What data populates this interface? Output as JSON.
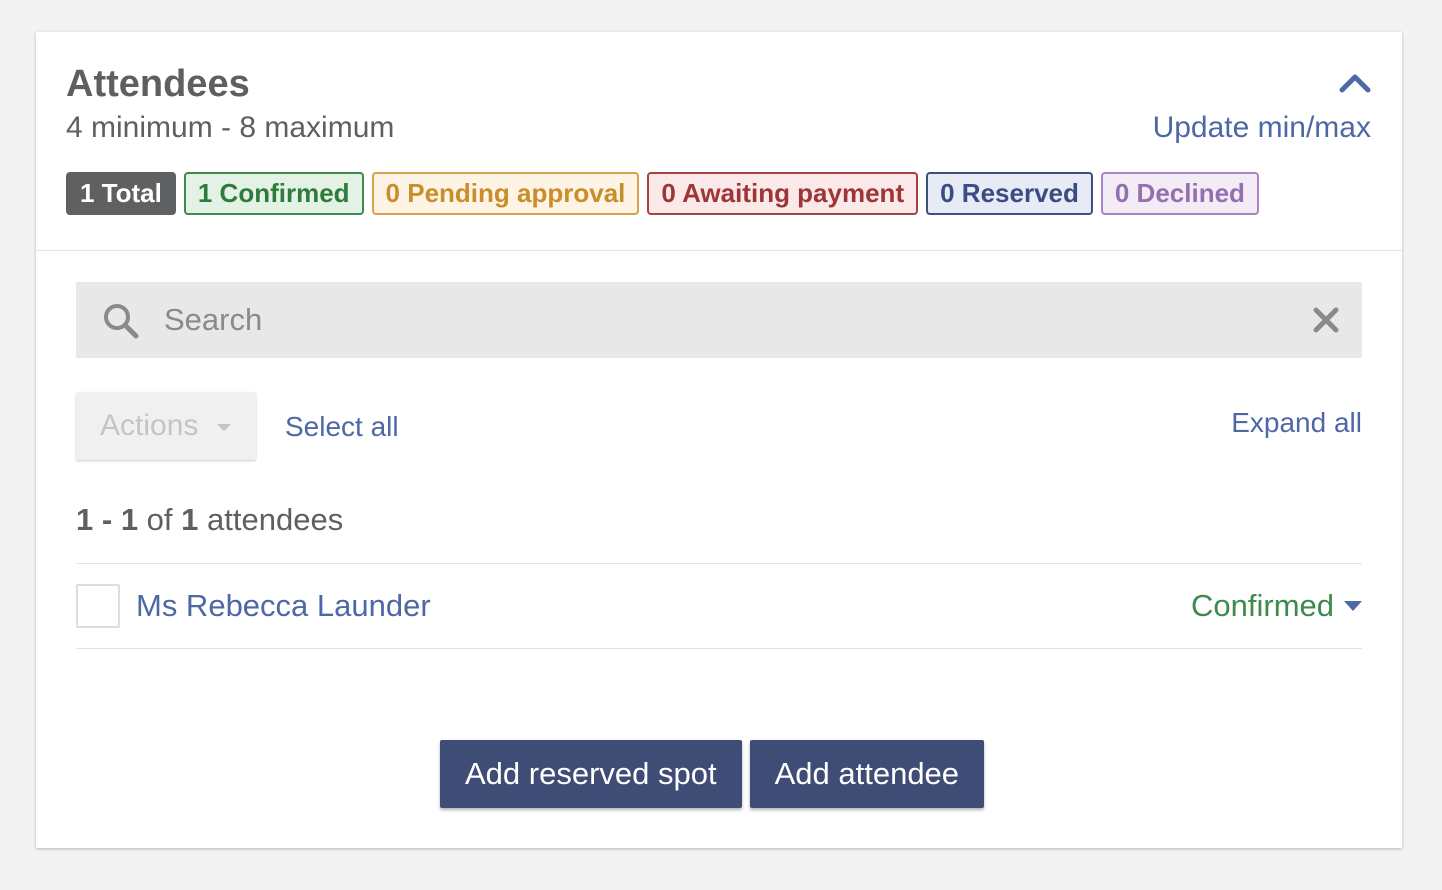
{
  "header": {
    "title": "Attendees",
    "subtitle": "4 minimum - 8 maximum",
    "update_link": "Update min/max",
    "collapse_icon": "chevron-up-icon"
  },
  "badges": {
    "total": "1 Total",
    "confirmed": "1 Confirmed",
    "pending": "0 Pending approval",
    "awaiting": "0 Awaiting payment",
    "reserved": "0 Reserved",
    "declined": "0 Declined"
  },
  "search": {
    "placeholder": "Search",
    "value": ""
  },
  "toolbar": {
    "actions_label": "Actions",
    "select_all": "Select all",
    "expand_all": "Expand all"
  },
  "count": {
    "start": "1",
    "separator": " - ",
    "end": "1",
    "of": " of ",
    "total": "1",
    "suffix": " attendees"
  },
  "attendees": [
    {
      "name": "Ms Rebecca Launder",
      "status": "Confirmed"
    }
  ],
  "footer": {
    "add_reserved": "Add reserved spot",
    "add_attendee": "Add attendee"
  },
  "colors": {
    "link": "#4e68a5",
    "confirmed": "#3e8a4c",
    "primary_button": "#3f4c76"
  }
}
